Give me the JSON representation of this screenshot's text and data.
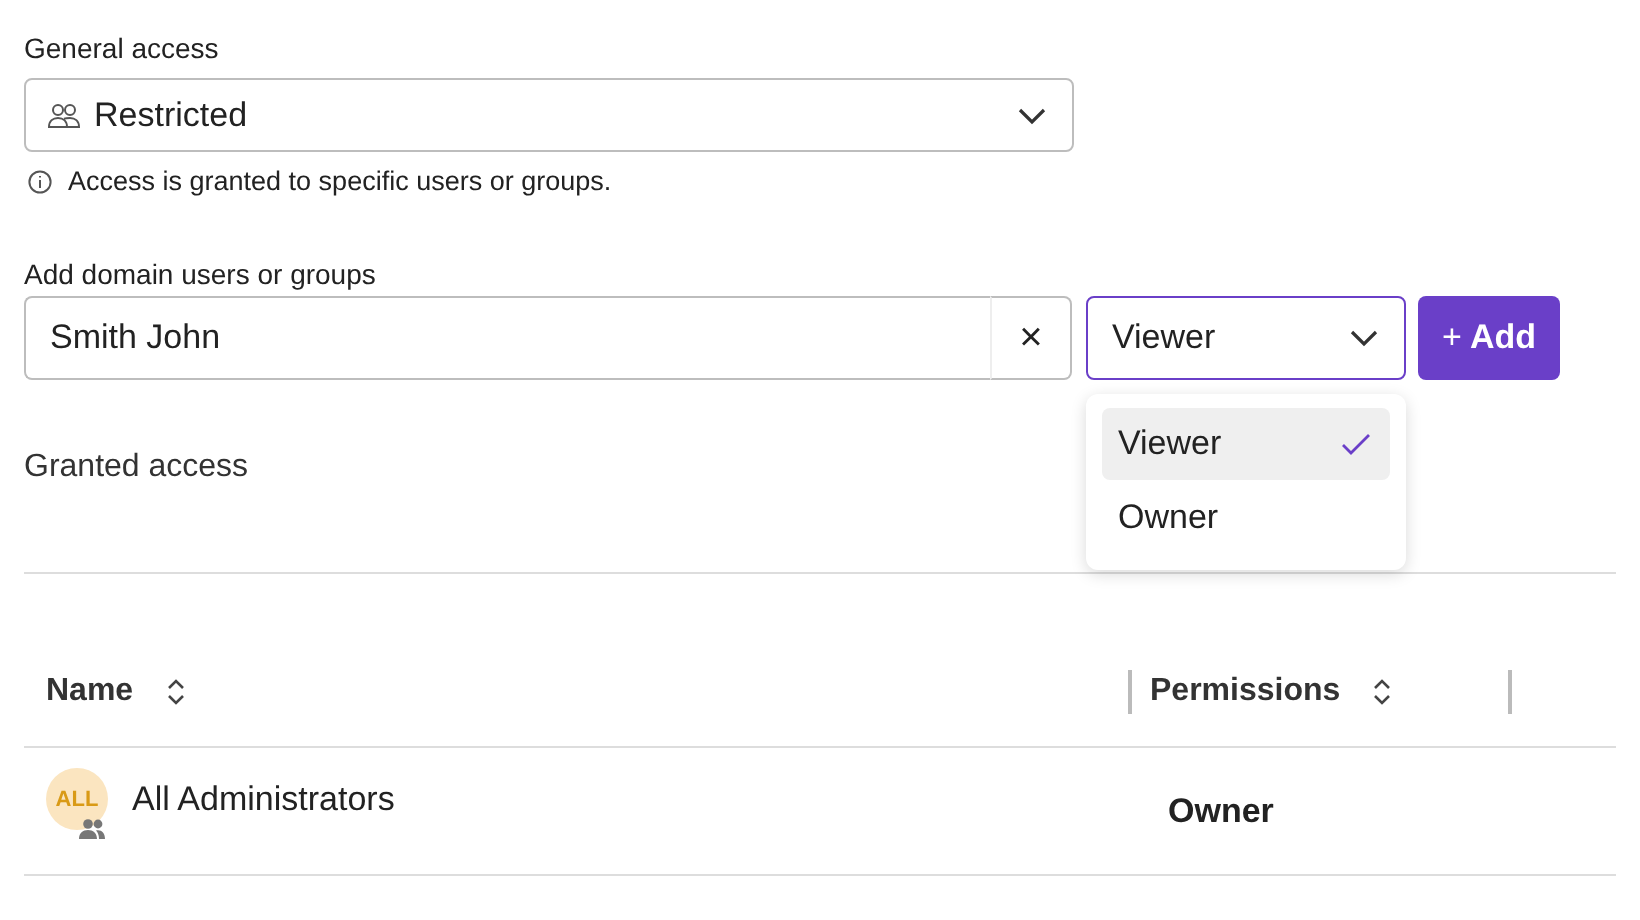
{
  "general_access": {
    "label": "General access",
    "value": "Restricted",
    "hint": "Access is granted to specific users or groups."
  },
  "add_users": {
    "label": "Add domain users or groups",
    "value": "Smith John",
    "clear": "×",
    "role": "Viewer",
    "add_button": "Add",
    "add_icon": "+",
    "menu": [
      {
        "label": "Viewer",
        "selected": true
      },
      {
        "label": "Owner",
        "selected": false
      }
    ]
  },
  "granted": {
    "title": "Granted access"
  },
  "table": {
    "columns": [
      "Name",
      "Permissions"
    ],
    "rows": [
      {
        "avatar": "ALL",
        "name": "All Administrators",
        "group": true,
        "permission": "Owner"
      }
    ]
  }
}
